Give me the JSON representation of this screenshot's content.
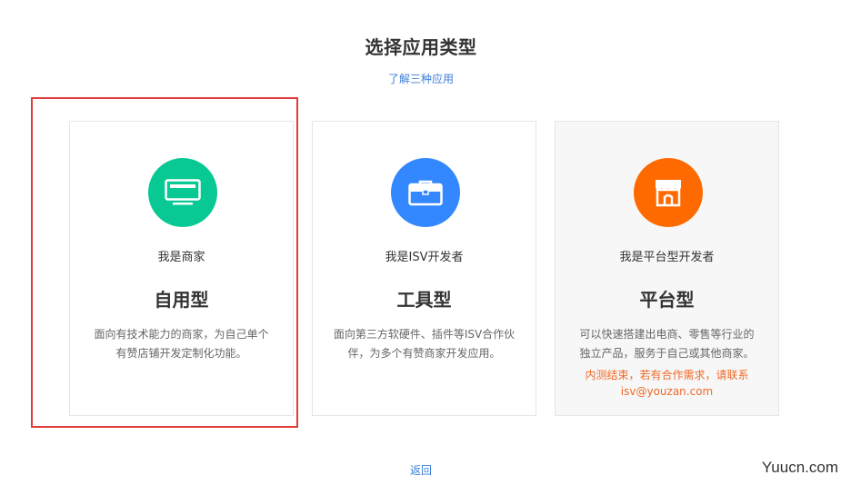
{
  "page": {
    "title": "选择应用类型",
    "learn_link": "了解三种应用",
    "back_link": "返回",
    "watermark": "Yuucn.com"
  },
  "colors": {
    "merchant": "#08c994",
    "isv": "#3388ff",
    "platform": "#ff6a00",
    "notice": "#f06a28",
    "link": "#3d7fd6",
    "highlight": "#e23b3b"
  },
  "cards": [
    {
      "icon": "monitor-icon",
      "role": "我是商家",
      "type": "自用型",
      "desc": "面向有技术能力的商家，为自己单个有赞店铺开发定制化功能。",
      "notice": ""
    },
    {
      "icon": "briefcase-icon",
      "role": "我是ISV开发者",
      "type": "工具型",
      "desc": "面向第三方软硬件、插件等ISV合作伙伴，为多个有赞商家开发应用。",
      "notice": ""
    },
    {
      "icon": "storefront-icon",
      "role": "我是平台型开发者",
      "type": "平台型",
      "desc": "可以快速搭建出电商、零售等行业的独立产品，服务于自己或其他商家。",
      "notice": "内测结束，若有合作需求，请联系isv@youzan.com"
    }
  ]
}
